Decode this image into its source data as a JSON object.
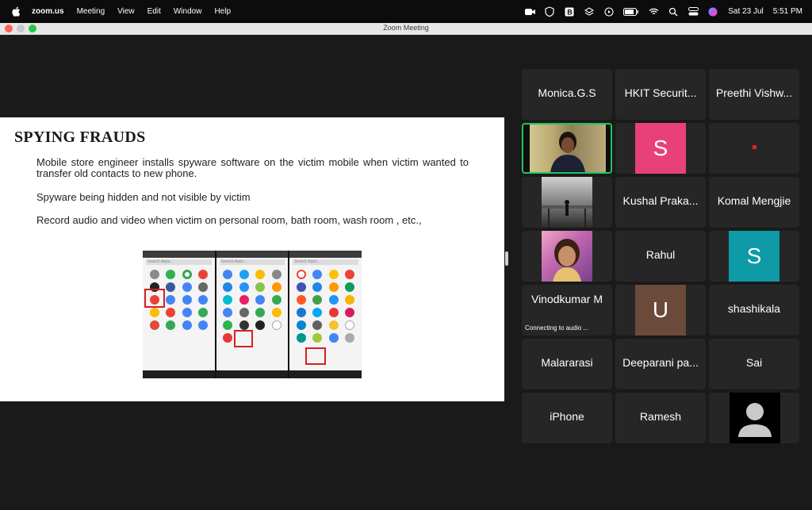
{
  "menubar": {
    "app_name": "zoom.us",
    "menus": [
      "Meeting",
      "View",
      "Edit",
      "Window",
      "Help"
    ],
    "date": "Sat 23 Jul",
    "time": "5:51 PM",
    "icons": [
      "zoom-icon",
      "vpn-shield-icon",
      "app-b-icon",
      "layers-icon",
      "play-icon",
      "battery-icon",
      "wifi-icon",
      "search-icon",
      "control-center-icon",
      "siri-icon"
    ]
  },
  "window": {
    "title": "Zoom Meeting"
  },
  "slide": {
    "title": "SPYING FRAUDS",
    "paragraphs": [
      "Mobile store engineer installs spyware software on the victim mobile when victim wanted to transfer old contacts to new phone.",
      "Spyware being hidden and not visible by victim",
      "Record audio and video when victim on personal room, bath room, wash room , etc.,"
    ],
    "phone_search_text": "Search Apps..."
  },
  "participants": [
    {
      "name": "Monica.G.S",
      "type": "name"
    },
    {
      "name": "HKIT Securit...",
      "type": "name"
    },
    {
      "name": "Preethi Vishw...",
      "type": "name"
    },
    {
      "name": "",
      "type": "video",
      "active": true
    },
    {
      "name": "",
      "type": "avatar",
      "letter": "S",
      "color": "#e8417a"
    },
    {
      "name": "",
      "type": "dot"
    },
    {
      "name": "",
      "type": "photo"
    },
    {
      "name": "Kushal Praka...",
      "type": "name"
    },
    {
      "name": "Komal Mengjie",
      "type": "name"
    },
    {
      "name": "",
      "type": "photo"
    },
    {
      "name": "Rahul",
      "type": "name"
    },
    {
      "name": "",
      "type": "avatar",
      "letter": "S",
      "color": "#0e9aa7"
    },
    {
      "name": "Vinodkumar M",
      "type": "name",
      "status": "Connecting to audio ..."
    },
    {
      "name": "",
      "type": "avatar",
      "letter": "U",
      "color": "#6b4a3a"
    },
    {
      "name": "shashikala",
      "type": "name"
    },
    {
      "name": "Malararasi",
      "type": "name"
    },
    {
      "name": "Deeparani pa...",
      "type": "name"
    },
    {
      "name": "Sai",
      "type": "name"
    },
    {
      "name": "iPhone",
      "type": "name"
    },
    {
      "name": "Ramesh",
      "type": "name"
    },
    {
      "name": "",
      "type": "default-avatar"
    }
  ]
}
